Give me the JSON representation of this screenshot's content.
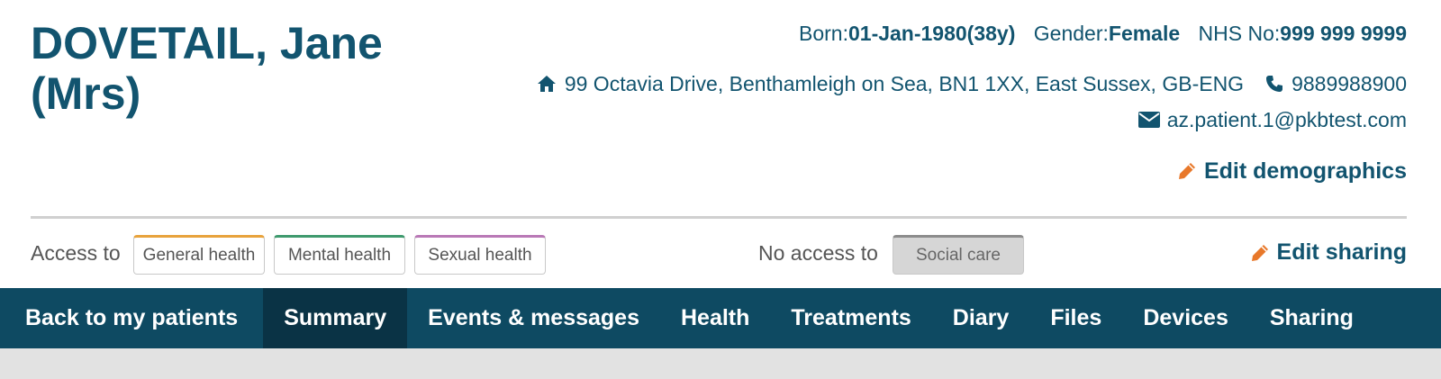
{
  "patient": {
    "name": "DOVETAIL, Jane (Mrs)",
    "born_label": "Born:",
    "born_value": "01-Jan-1980(38y)",
    "gender_label": "Gender:",
    "gender_value": "Female",
    "nhs_label": "NHS No:",
    "nhs_value": "999 999 9999",
    "address": "99 Octavia Drive, Benthamleigh on Sea, BN1 1XX, East Sussex, GB-ENG",
    "phone": "9889988900",
    "email": "az.patient.1@pkbtest.com",
    "icons": {
      "address": "home-icon",
      "phone": "phone-icon",
      "email": "envelope-icon"
    }
  },
  "actions": {
    "edit_demographics": "Edit demographics",
    "edit_sharing": "Edit sharing",
    "icon": "pencil-icon"
  },
  "access": {
    "access_to_label": "Access to",
    "tags": [
      {
        "label": "General health",
        "color": "#e8a33d"
      },
      {
        "label": "Mental health",
        "color": "#3f9a6e"
      },
      {
        "label": "Sexual health",
        "color": "#b979b6"
      }
    ],
    "no_access_label": "No access to",
    "no_access_tags": [
      {
        "label": "Social care",
        "color": "#8c8c8c"
      }
    ]
  },
  "nav": {
    "items": [
      {
        "label": "Back to my patients"
      },
      {
        "label": "Summary",
        "active": true
      },
      {
        "label": "Events & messages"
      },
      {
        "label": "Health"
      },
      {
        "label": "Treatments"
      },
      {
        "label": "Diary"
      },
      {
        "label": "Files"
      },
      {
        "label": "Devices"
      },
      {
        "label": "Sharing"
      }
    ]
  },
  "colors": {
    "brand": "#12546f",
    "nav_bg": "#0e4a62",
    "nav_active_bg": "#0a3345",
    "accent": "#e8782a"
  }
}
